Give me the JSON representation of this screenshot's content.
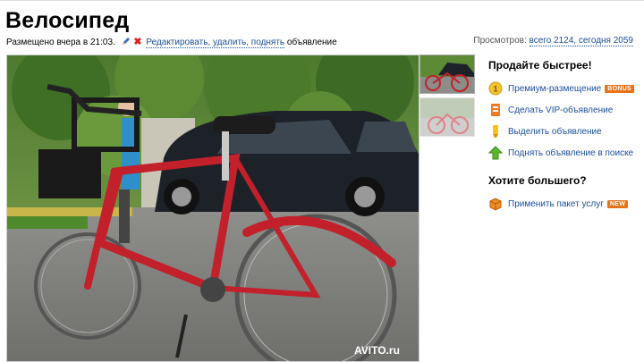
{
  "listing": {
    "title": "Велосипед",
    "posted": "Размещено вчера в 21:03.",
    "actions_link": "Редактировать, удалить, поднять",
    "actions_tail": "объявление",
    "views_label": "Просмотров:",
    "views_value": "всего 2124, сегодня 2059"
  },
  "photo": {
    "watermark": "AVITO.ru",
    "icons": [
      "bicycle-photo",
      "car-photo",
      "tree-photo"
    ]
  },
  "sell_faster": {
    "title": "Продайте быстрее!",
    "items": [
      {
        "label": "Премиум-размещение",
        "badge": "BONUS",
        "icon": "premium-coin-icon"
      },
      {
        "label": "Сделать VIP-объявление",
        "icon": "vip-icon"
      },
      {
        "label": "Выделить объявление",
        "icon": "highlighter-icon"
      },
      {
        "label": "Поднять объявление в поиске",
        "icon": "green-up-arrow-icon"
      }
    ]
  },
  "want_more": {
    "title": "Хотите большего?",
    "items": [
      {
        "label": "Применить пакет услуг",
        "badge": "NEW",
        "icon": "package-box-icon"
      }
    ]
  },
  "colors": {
    "link": "#1a4e9e",
    "badge": "#e8731a",
    "bike": "#c2202b"
  }
}
